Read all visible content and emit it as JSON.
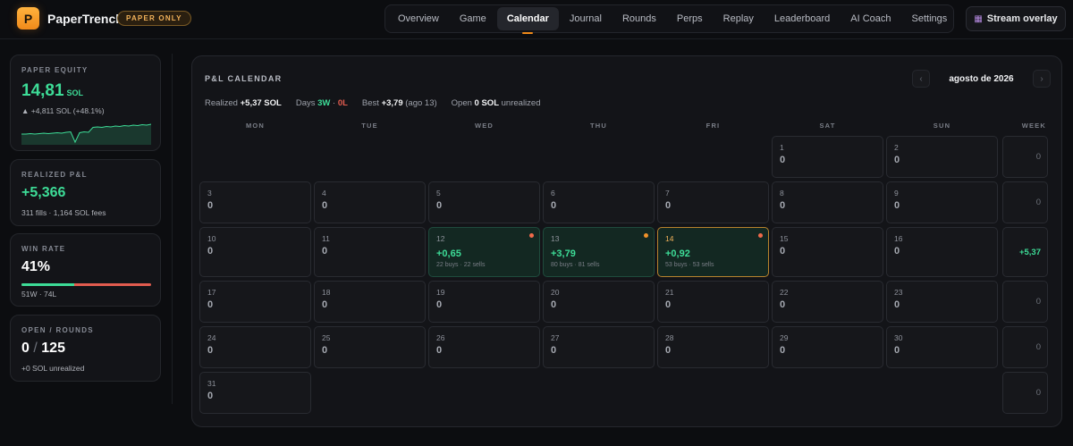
{
  "header": {
    "logo_letter": "P",
    "brand": "PaperTrench",
    "badge": "PAPER ONLY",
    "tabs": [
      {
        "label": "Overview"
      },
      {
        "label": "Game"
      },
      {
        "label": "Calendar"
      },
      {
        "label": "Journal"
      },
      {
        "label": "Rounds"
      },
      {
        "label": "Perps"
      },
      {
        "label": "Replay"
      },
      {
        "label": "Leaderboard"
      },
      {
        "label": "AI Coach"
      },
      {
        "label": "Settings"
      }
    ],
    "active_tab": "Calendar",
    "stream_overlay": "Stream overlay",
    "stream_icon": "screen-icon"
  },
  "sidebar": {
    "equity": {
      "label": "PAPER EQUITY",
      "value": "14,81",
      "unit": "SOL",
      "change": "▲ +4,811 SOL (+48.1%)",
      "sparkline": [
        10.0,
        10.0,
        10.1,
        10.0,
        10.1,
        10.2,
        10.1,
        10.2,
        10.3,
        10.2,
        10.4,
        10.5,
        8.2,
        10.3,
        10.5,
        10.4,
        11.5,
        11.6,
        11.5,
        11.7,
        11.6,
        11.8,
        11.7,
        11.9,
        11.8,
        12.0,
        11.9,
        12.1,
        12.0,
        12.2
      ]
    },
    "realized": {
      "label": "REALIZED P&L",
      "value": "+5,366",
      "sub": "311 fills · 1,164 SOL fees"
    },
    "winrate": {
      "label": "WIN RATE",
      "value": "41%",
      "win_fraction": 0.41,
      "sub": "51W · 74L"
    },
    "open_rounds": {
      "label": "OPEN / ROUNDS",
      "open": "0",
      "separator": "/",
      "rounds": "125",
      "sub": "+0 SOL unrealized"
    }
  },
  "calendar": {
    "title": "P&L CALENDAR",
    "month": "agosto de 2026",
    "prev_icon": "chevron-left-icon",
    "next_icon": "chevron-right-icon",
    "summary": {
      "realized_label": "Realized",
      "realized_value": "+5,37 SOL",
      "days_label": "Days",
      "days_w": "3W",
      "days_sep": " · ",
      "days_l": "0L",
      "best_label": "Best",
      "best_value": "+3,79",
      "best_date": "(ago 13)",
      "open_label": "Open",
      "open_value": "0 SOL",
      "open_suffix": "unrealized"
    },
    "weekdays": [
      "MON",
      "TUE",
      "WED",
      "THU",
      "FRI",
      "SAT",
      "SUN"
    ],
    "week_label": "WEEK",
    "weeks": [
      {
        "days": [
          null,
          null,
          null,
          null,
          null,
          {
            "n": "1",
            "v": "0"
          },
          {
            "n": "2",
            "v": "0"
          }
        ],
        "total": "0"
      },
      {
        "days": [
          {
            "n": "3",
            "v": "0"
          },
          {
            "n": "4",
            "v": "0"
          },
          {
            "n": "5",
            "v": "0"
          },
          {
            "n": "6",
            "v": "0"
          },
          {
            "n": "7",
            "v": "0"
          },
          {
            "n": "8",
            "v": "0"
          },
          {
            "n": "9",
            "v": "0"
          }
        ],
        "total": "0"
      },
      {
        "days": [
          {
            "n": "10",
            "v": "0"
          },
          {
            "n": "11",
            "v": "0"
          },
          {
            "n": "12",
            "v": "+0,65",
            "trades": "22 buys · 22 sells",
            "profit": true,
            "dot": "#f06a4a"
          },
          {
            "n": "13",
            "v": "+3,79",
            "trades": "80 buys · 81 sells",
            "profit": true,
            "dot": "#f0922a"
          },
          {
            "n": "14",
            "v": "+0,92",
            "trades": "53 buys · 53 sells",
            "profit": true,
            "today": true,
            "dot": "#f06a4a"
          },
          {
            "n": "15",
            "v": "0"
          },
          {
            "n": "16",
            "v": "0"
          }
        ],
        "total": "+5,37",
        "positive": true
      },
      {
        "days": [
          {
            "n": "17",
            "v": "0"
          },
          {
            "n": "18",
            "v": "0"
          },
          {
            "n": "19",
            "v": "0"
          },
          {
            "n": "20",
            "v": "0"
          },
          {
            "n": "21",
            "v": "0"
          },
          {
            "n": "22",
            "v": "0"
          },
          {
            "n": "23",
            "v": "0"
          }
        ],
        "total": "0"
      },
      {
        "days": [
          {
            "n": "24",
            "v": "0"
          },
          {
            "n": "25",
            "v": "0"
          },
          {
            "n": "26",
            "v": "0"
          },
          {
            "n": "27",
            "v": "0"
          },
          {
            "n": "28",
            "v": "0"
          },
          {
            "n": "29",
            "v": "0"
          },
          {
            "n": "30",
            "v": "0"
          }
        ],
        "total": "0"
      },
      {
        "days": [
          {
            "n": "31",
            "v": "0"
          },
          null,
          null,
          null,
          null,
          null,
          null
        ],
        "total": "0"
      }
    ]
  }
}
